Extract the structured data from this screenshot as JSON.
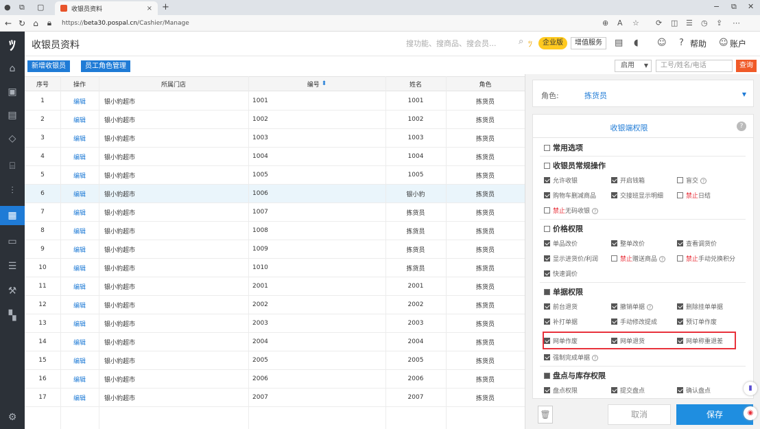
{
  "browser": {
    "tab_title": "收银员资料",
    "url_prefix": "https://",
    "url_host": "beta30.pospal.cn",
    "url_path": "/Cashier/Manage"
  },
  "header": {
    "title": "收银员资料",
    "search_placeholder": "搜功能、搜商品、搜会员...",
    "edition": "企业版",
    "value_added": "增值服务",
    "help": "帮助",
    "account": "账户"
  },
  "toolbar": {
    "add_cashier": "新增收银员",
    "role_manage": "员工角色管理",
    "status": "启用",
    "query_placeholder": "工号/姓名/电话",
    "query_btn": "查询"
  },
  "table": {
    "columns": [
      "序号",
      "操作",
      "所属门店",
      "编号",
      "姓名",
      "角色"
    ],
    "sort_icon": "⬍",
    "rows": [
      {
        "no": "1",
        "op": "编辑",
        "store": "银小豹超市",
        "code": "1001",
        "name": "1001",
        "role": "拣货员"
      },
      {
        "no": "2",
        "op": "编辑",
        "store": "银小豹超市",
        "code": "1002",
        "name": "1002",
        "role": "拣货员"
      },
      {
        "no": "3",
        "op": "编辑",
        "store": "银小豹超市",
        "code": "1003",
        "name": "1003",
        "role": "拣货员"
      },
      {
        "no": "4",
        "op": "编辑",
        "store": "银小豹超市",
        "code": "1004",
        "name": "1004",
        "role": "拣货员"
      },
      {
        "no": "5",
        "op": "编辑",
        "store": "银小豹超市",
        "code": "1005",
        "name": "1005",
        "role": "拣货员"
      },
      {
        "no": "6",
        "op": "编辑",
        "store": "银小豹超市",
        "code": "1006",
        "name": "银小豹",
        "role": "拣货员"
      },
      {
        "no": "7",
        "op": "编辑",
        "store": "银小豹超市",
        "code": "1007",
        "name": "拣货员",
        "role": "拣货员"
      },
      {
        "no": "8",
        "op": "编辑",
        "store": "银小豹超市",
        "code": "1008",
        "name": "拣货员",
        "role": "拣货员"
      },
      {
        "no": "9",
        "op": "编辑",
        "store": "银小豹超市",
        "code": "1009",
        "name": "拣货员",
        "role": "拣货员"
      },
      {
        "no": "10",
        "op": "编辑",
        "store": "银小豹超市",
        "code": "1010",
        "name": "拣货员",
        "role": "拣货员"
      },
      {
        "no": "11",
        "op": "编辑",
        "store": "银小豹超市",
        "code": "2001",
        "name": "2001",
        "role": "拣货员"
      },
      {
        "no": "12",
        "op": "编辑",
        "store": "银小豹超市",
        "code": "2002",
        "name": "2002",
        "role": "拣货员"
      },
      {
        "no": "13",
        "op": "编辑",
        "store": "银小豹超市",
        "code": "2003",
        "name": "2003",
        "role": "拣货员"
      },
      {
        "no": "14",
        "op": "编辑",
        "store": "银小豹超市",
        "code": "2004",
        "name": "2004",
        "role": "拣货员"
      },
      {
        "no": "15",
        "op": "编辑",
        "store": "银小豹超市",
        "code": "2005",
        "name": "2005",
        "role": "拣货员"
      },
      {
        "no": "16",
        "op": "编辑",
        "store": "银小豹超市",
        "code": "2006",
        "name": "2006",
        "role": "拣货员"
      },
      {
        "no": "17",
        "op": "编辑",
        "store": "银小豹超市",
        "code": "2007",
        "name": "2007",
        "role": "拣货员"
      }
    ]
  },
  "panel": {
    "role_label": "角色:",
    "role_value": "拣货员",
    "perm_title": "收银端权限",
    "sections": {
      "common": "常用选项",
      "routine": "收银员常规操作",
      "price": "价格权限",
      "doc": "单据权限",
      "stock": "盘点与库存权限"
    },
    "perms": {
      "allow_checkout": "允许收银",
      "open_drawer": "开启钱箱",
      "blind_handover": "盲交",
      "cart_delete": "购物车删减商品",
      "handover_detail": "交接班显示明细",
      "forbid": "禁止",
      "daily_settle": "日结",
      "no_code_checkout": "无码收银",
      "item_price": "单品改价",
      "whole_price": "整单改价",
      "view_adjust": "查看调货价",
      "show_cost": "显示进货价/利润",
      "gift_goods": "赠送商品",
      "manual_points": "手动兑换积分",
      "quick_adjust": "快速调价",
      "front_return": "前台退货",
      "cancel_doc": "撤销单据",
      "delete_hang": "删除挂单单据",
      "reprint": "补打单据",
      "edit_commission": "手动修改提成",
      "preorder_void": "预订单作废",
      "online_void": "网单作废",
      "online_return": "网单退货",
      "online_weigh_refund": "网单称重退差",
      "force_complete": "强制完成单据",
      "stock_perm": "盘点权限",
      "submit_stock": "提交盘点",
      "confirm_stock": "确认盘点"
    },
    "cancel": "取消",
    "save": "保存"
  },
  "colors": {
    "accent": "#1f7bd6",
    "sidebar": "#2c3138",
    "query": "#f05a28",
    "highlight_frame": "#e8303a",
    "edition": "#ffc91f"
  }
}
